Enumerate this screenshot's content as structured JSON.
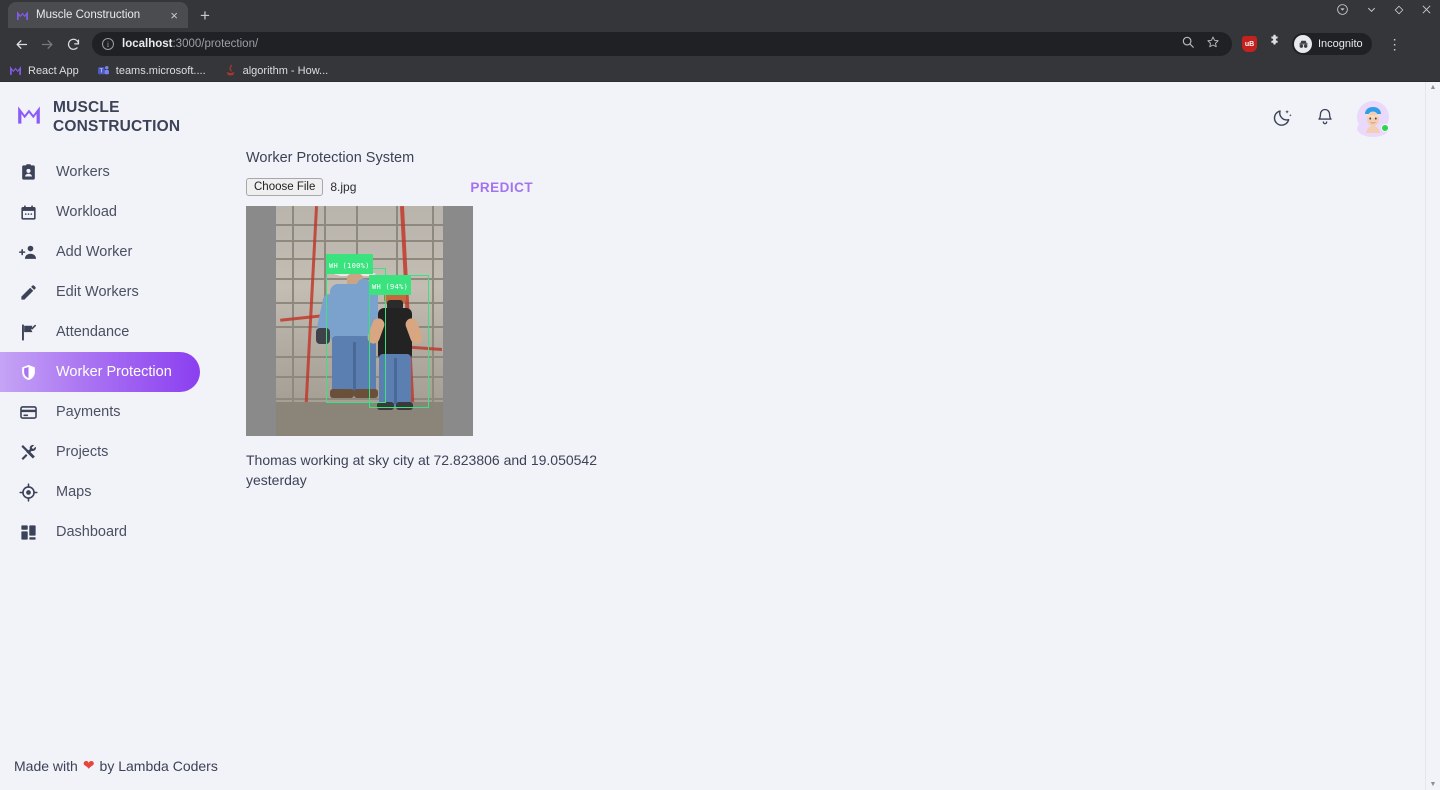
{
  "browser": {
    "tab": {
      "title": "Muscle Construction",
      "favicon": "muscle-logo-icon",
      "close": "×"
    },
    "new_tab_label": "+",
    "window_controls": [
      "record-icon",
      "minimize-icon",
      "maximize-icon",
      "close-icon"
    ],
    "nav": {
      "back": "←",
      "forward": "→",
      "reload": "⟳",
      "menu": "⋮"
    },
    "omnibox": {
      "info_icon": "i",
      "url_host": "localhost",
      "url_path": ":3000/protection/",
      "zoom_icon": "search-zoom-icon",
      "bookmark_icon": "star-icon"
    },
    "extensions": {
      "adblock_badge": "uB",
      "puzzle": "extensions-icon"
    },
    "incognito_label": "Incognito",
    "bookmarks": [
      {
        "label": "React App",
        "icon": "muscle-logo-icon"
      },
      {
        "label": "teams.microsoft....",
        "icon": "teams-icon"
      },
      {
        "label": "algorithm - How...",
        "icon": "java-icon"
      }
    ]
  },
  "app": {
    "brand": {
      "line1": "MUSCLE",
      "line2": "CONSTRUCTION",
      "logo": "muscle-m-logo-icon"
    },
    "header_actions": [
      {
        "name": "dark-mode-toggle",
        "icon": "moon-stars-icon"
      },
      {
        "name": "notifications-button",
        "icon": "bell-icon"
      },
      {
        "name": "user-avatar",
        "icon": "avatar",
        "status": "online"
      }
    ],
    "sidebar": {
      "items": [
        {
          "label": "Workers",
          "icon": "contact-card-icon",
          "active": false
        },
        {
          "label": "Workload",
          "icon": "calendar-icon",
          "active": false
        },
        {
          "label": "Add Worker",
          "icon": "person-add-icon",
          "active": false
        },
        {
          "label": "Edit Workers",
          "icon": "pencil-icon",
          "active": false
        },
        {
          "label": "Attendance",
          "icon": "flag-check-icon",
          "active": false
        },
        {
          "label": "Worker Protection",
          "icon": "shield-icon",
          "active": true
        },
        {
          "label": "Payments",
          "icon": "credit-card-icon",
          "active": false
        },
        {
          "label": "Projects",
          "icon": "tools-icon",
          "active": false
        },
        {
          "label": "Maps",
          "icon": "target-icon",
          "active": false
        },
        {
          "label": "Dashboard",
          "icon": "dashboard-grid-icon",
          "active": false
        }
      ]
    },
    "main": {
      "title": "Worker Protection System",
      "file_input": {
        "button_label": "Choose File",
        "file_name": "8.jpg"
      },
      "predict_label": "PREDICT",
      "detections": [
        {
          "label": "WH (100%)",
          "class": "WH",
          "confidence": "100%"
        },
        {
          "label": "WH (94%)",
          "class": "WH",
          "confidence": "94%"
        }
      ],
      "caption": "Thomas working at sky city at 72.823806 and 19.050542 yesterday"
    },
    "footer": {
      "prefix": "Made with",
      "heart": "❤",
      "suffix": "by Lambda Coders"
    },
    "colors": {
      "accent_purple": "#8b3ff0",
      "accent_light": "#a473f0",
      "detection_green": "#3be37f",
      "page_bg": "#f2f3f9",
      "text": "#3c4257",
      "heart_red": "#e8453c",
      "online_green": "#2fd44c"
    }
  },
  "scrollbar": {
    "up": "▲",
    "down": "▼"
  }
}
